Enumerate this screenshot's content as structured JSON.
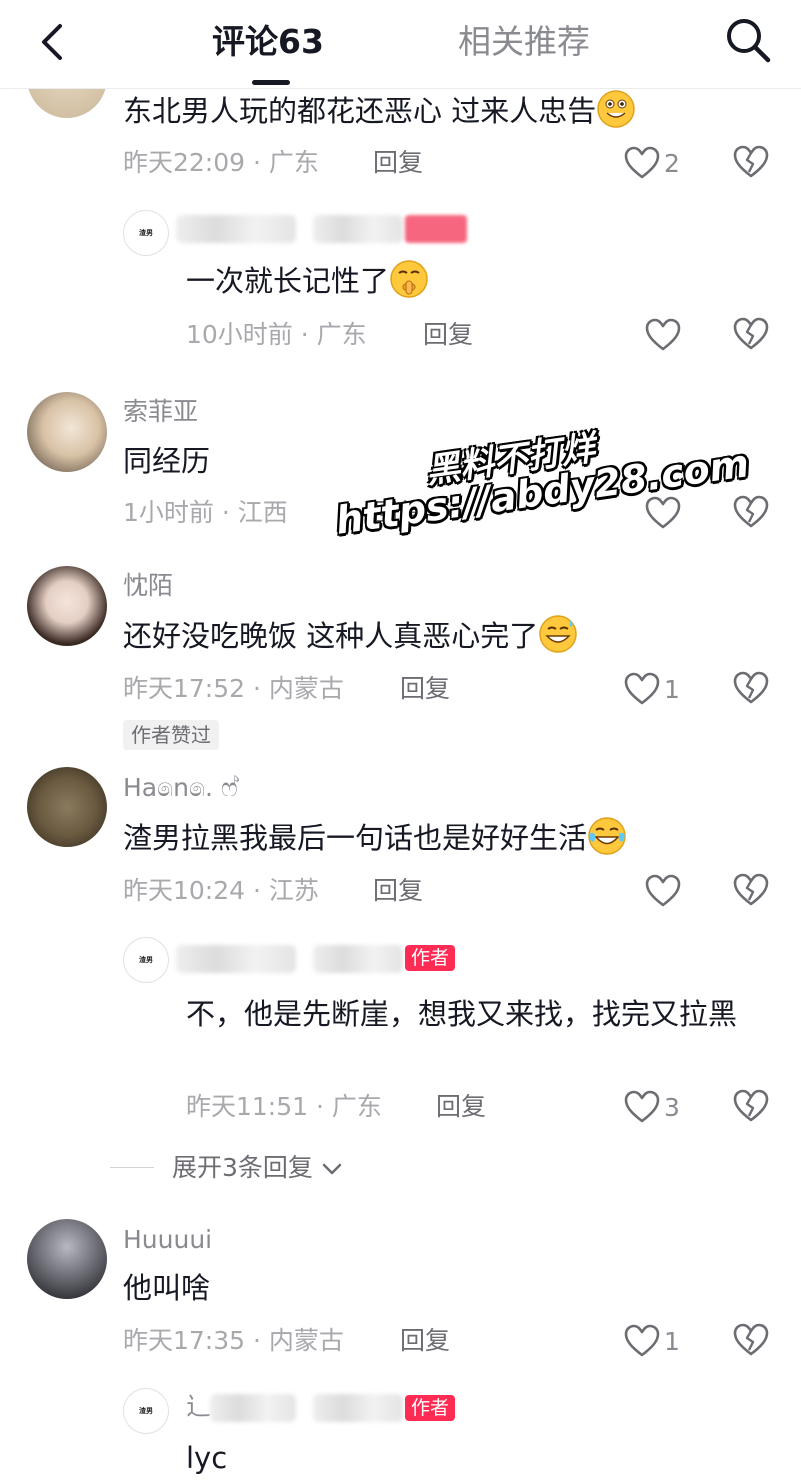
{
  "header": {
    "tab_comments": "评论63",
    "tab_recommend": "相关推荐"
  },
  "watermark": {
    "line1": "黑料不打烊",
    "line2": "https://abdy28.com"
  },
  "comments": [
    {
      "text": "东北男人玩的都花还恶心 过来人忠告",
      "emoji": "grinning-emoji",
      "time": "昨天22:09 · 广东",
      "reply": "回复",
      "likes": "2",
      "replies": [
        {
          "avatar_text": "渣男",
          "text": "一次就长记性了",
          "emoji": "shush-emoji",
          "time": "10小时前 · 广东",
          "reply": "回复",
          "likes": ""
        }
      ]
    },
    {
      "username": "索菲亚",
      "text": "同经历",
      "time": "1小时前 · 江西",
      "reply": "回复",
      "likes": ""
    },
    {
      "username": "忱陌",
      "text": "还好没吃晚饭 这种人真恶心完了",
      "emoji": "sweat-smile-emoji",
      "time": "昨天17:52 · 内蒙古",
      "reply": "回复",
      "likes": "1",
      "badge": "作者赞过"
    },
    {
      "username": "Ha෧n෧. ෆ්",
      "text": "渣男拉黑我最后一句话也是好好生活",
      "emoji": "tears-of-joy-emoji",
      "time": "昨天10:24 · 江苏",
      "reply": "回复",
      "likes": "",
      "replies": [
        {
          "avatar_text": "渣男",
          "author_tag": "作者",
          "text": "不，他是先断崖，想我又来找，找完又拉黑",
          "time": "昨天11:51 · 广东",
          "reply": "回复",
          "likes": "3"
        }
      ],
      "expand": "展开3条回复"
    },
    {
      "username": "Huuuui",
      "text": "他叫啥",
      "time": "昨天17:35 · 内蒙古",
      "reply": "回复",
      "likes": "1",
      "replies": [
        {
          "avatar_text": "渣男",
          "name_prefix": "辶",
          "author_tag": "作者",
          "text": "lyc"
        }
      ]
    }
  ],
  "colors": {
    "accent": "#fe2c55",
    "text": "#161823",
    "muted": "#8a8b91"
  }
}
